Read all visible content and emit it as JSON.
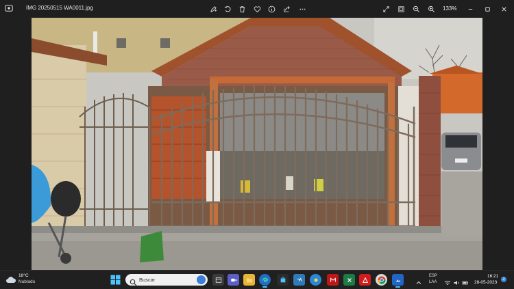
{
  "titlebar": {
    "filename": "IMG 20250515 WA0011.jpg",
    "zoom": "133%",
    "tools": [
      "edit-icon",
      "rotate-icon",
      "delete-icon",
      "favorite-icon",
      "info-icon",
      "share-icon",
      "more-icon"
    ],
    "window_controls": [
      "expand-icon",
      "fit-icon",
      "zoom-out-icon",
      "zoom-in-icon",
      "minimize-icon",
      "maximize-icon",
      "close-icon"
    ]
  },
  "taskbar": {
    "weather": {
      "temp": "18°C",
      "condition": "Nublado"
    },
    "search_placeholder": "Buscar",
    "apps": [
      "file-explorer-icon",
      "video-call-icon",
      "folder-icon",
      "edge-icon",
      "store-icon",
      "python-icon",
      "mcafee-icon",
      "excel-icon",
      "acrobat-icon",
      "chrome-icon",
      "photos-icon"
    ],
    "tray": {
      "lang_top": "ESP",
      "lang_bottom": "LAA",
      "time": "16:21",
      "date": "28-05-2023",
      "notifications": "2"
    }
  },
  "colors": {
    "titlebar_bg": "#1f1f1f",
    "taskbar_bg": "#202020",
    "accent": "#4cc2ff"
  }
}
